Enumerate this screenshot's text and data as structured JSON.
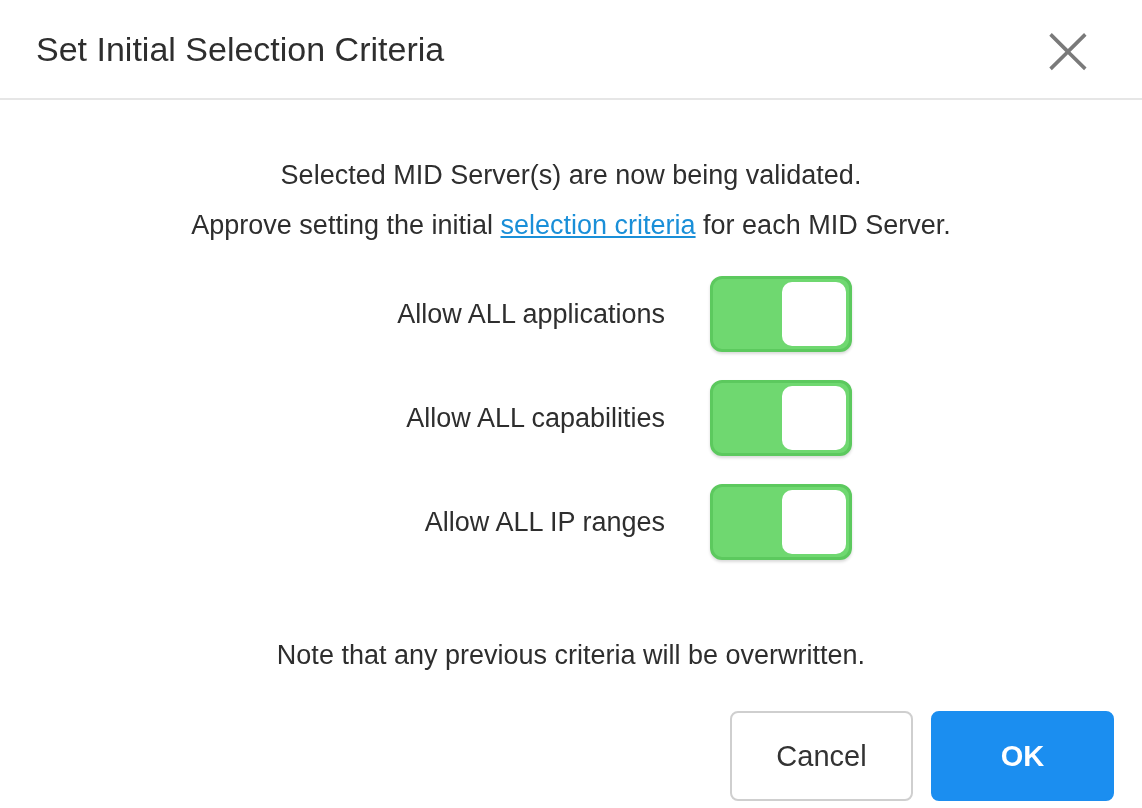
{
  "dialog": {
    "title": "Set Initial Selection Criteria",
    "close": "×"
  },
  "message": {
    "line_1": "Selected MID Server(s) are now being validated.",
    "line_2_before": "Approve setting the initial",
    "link": "selection criteria",
    "line_2_after": "for each MID Server."
  },
  "toggles": [
    {
      "label": "Allow ALL applications",
      "on": true
    },
    {
      "label": "Allow ALL capabilities",
      "on": true
    },
    {
      "label": "Allow ALL IP ranges",
      "on": true
    }
  ],
  "note": "Note that any previous criteria will be overwritten.",
  "buttons": [
    {
      "label": "Cancel",
      "kind": "secondary"
    },
    {
      "label": "OK",
      "kind": "primary"
    }
  ]
}
